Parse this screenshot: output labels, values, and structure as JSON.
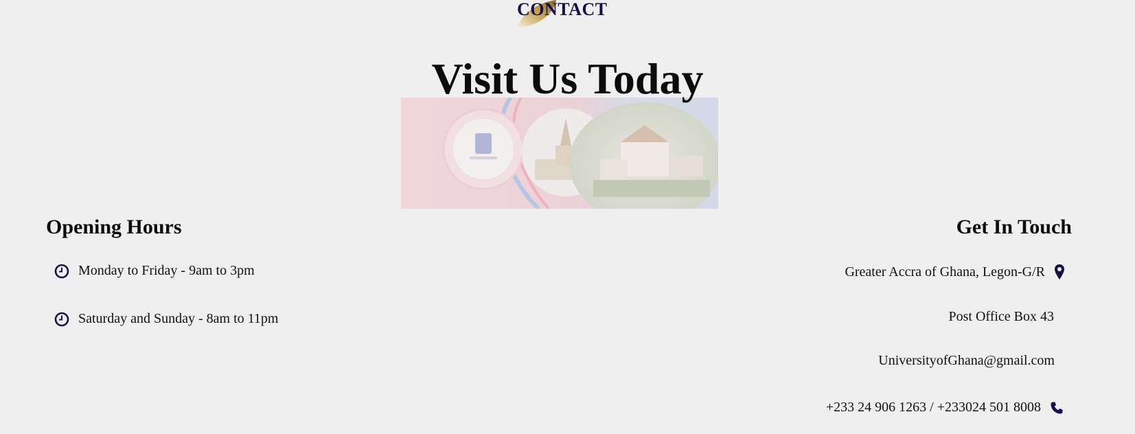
{
  "header": {
    "section_label": "CONTACT",
    "title": "Visit Us Today"
  },
  "opening_hours": {
    "heading": "Opening Hours",
    "items": [
      {
        "icon": "clock-icon",
        "text": "Monday to Friday - 9am to 3pm"
      },
      {
        "icon": "clock-icon",
        "text": "Saturday and Sunday - 8am to 11pm"
      }
    ]
  },
  "get_in_touch": {
    "heading": "Get In Touch",
    "address": "Greater Accra of Ghana, Legon-G/R",
    "address_icon": "map-marker-icon",
    "po_box": "Post Office Box 43",
    "email": "UniversityofGhana@gmail.com",
    "phone": "+233 24 906 1263 / +233024 501 8008",
    "phone_icon": "phone-icon"
  },
  "colors": {
    "background": "#efefef",
    "accent_navy": "#15104d",
    "swoosh_gold": "#b08a3a",
    "text": "#111111"
  }
}
